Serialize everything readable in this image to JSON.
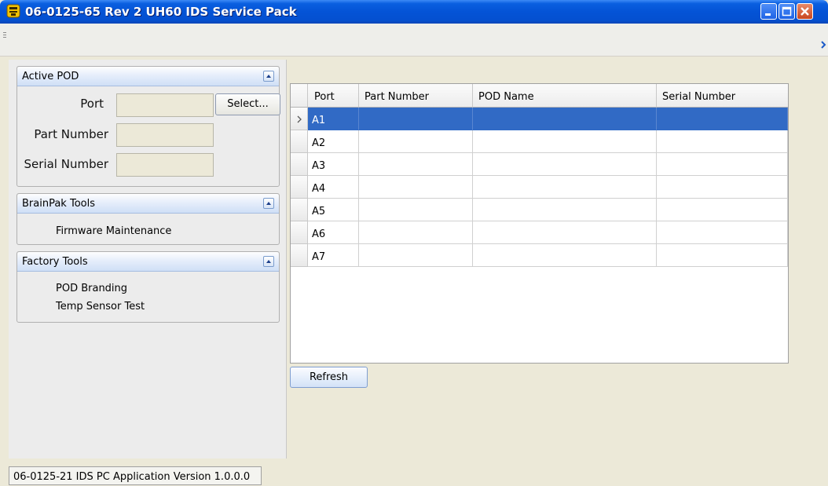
{
  "window": {
    "title": "06-0125-65 Rev 2 UH60 IDS Service Pack"
  },
  "active_pod": {
    "title": "Active POD",
    "port_label": "Port",
    "part_number_label": "Part Number",
    "serial_number_label": "Serial Number",
    "port_value": "",
    "part_number_value": "",
    "serial_number_value": "",
    "select_label": "Select..."
  },
  "brainpak": {
    "title": "BrainPak Tools",
    "items": [
      "Firmware Maintenance"
    ]
  },
  "factory": {
    "title": "Factory Tools",
    "items": [
      "POD Branding",
      "Temp Sensor Test"
    ]
  },
  "grid": {
    "columns": [
      "Port",
      "Part Number",
      "POD Name",
      "Serial Number"
    ],
    "rows": [
      {
        "port": "A1",
        "part_number": "",
        "pod_name": "",
        "serial_number": "",
        "selected": true
      },
      {
        "port": "A2",
        "part_number": "",
        "pod_name": "",
        "serial_number": ""
      },
      {
        "port": "A3",
        "part_number": "",
        "pod_name": "",
        "serial_number": ""
      },
      {
        "port": "A4",
        "part_number": "",
        "pod_name": "",
        "serial_number": ""
      },
      {
        "port": "A5",
        "part_number": "",
        "pod_name": "",
        "serial_number": ""
      },
      {
        "port": "A6",
        "part_number": "",
        "pod_name": "",
        "serial_number": ""
      },
      {
        "port": "A7",
        "part_number": "",
        "pod_name": "",
        "serial_number": ""
      }
    ]
  },
  "refresh_label": "Refresh",
  "status_text": "06-0125-21 IDS PC Application Version 1.0.0.0",
  "colors": {
    "titlebar": "#0453d6",
    "selection": "#316ac5"
  },
  "icons": [
    "app-icon",
    "minimize-icon",
    "maximize-icon",
    "close-icon",
    "grip-icon",
    "chevron-right-icon",
    "collapse-icon",
    "row-pointer-icon"
  ]
}
